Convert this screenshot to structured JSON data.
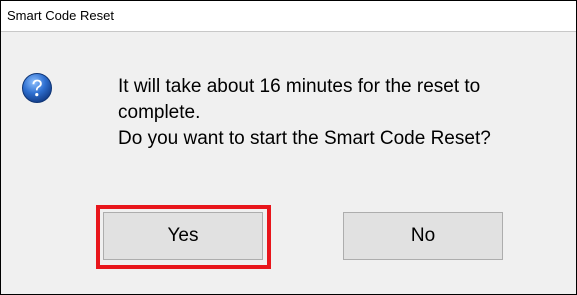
{
  "window": {
    "title": "Smart Code Reset"
  },
  "message": {
    "icon": "question-icon",
    "line1": "It will take about 16 minutes for the reset to complete.",
    "line2": "Do you want to start the Smart Code Reset?"
  },
  "buttons": {
    "yes_label": "Yes",
    "no_label": "No"
  },
  "colors": {
    "highlight": "#e8151b",
    "icon_blue": "#1e5fb4"
  }
}
